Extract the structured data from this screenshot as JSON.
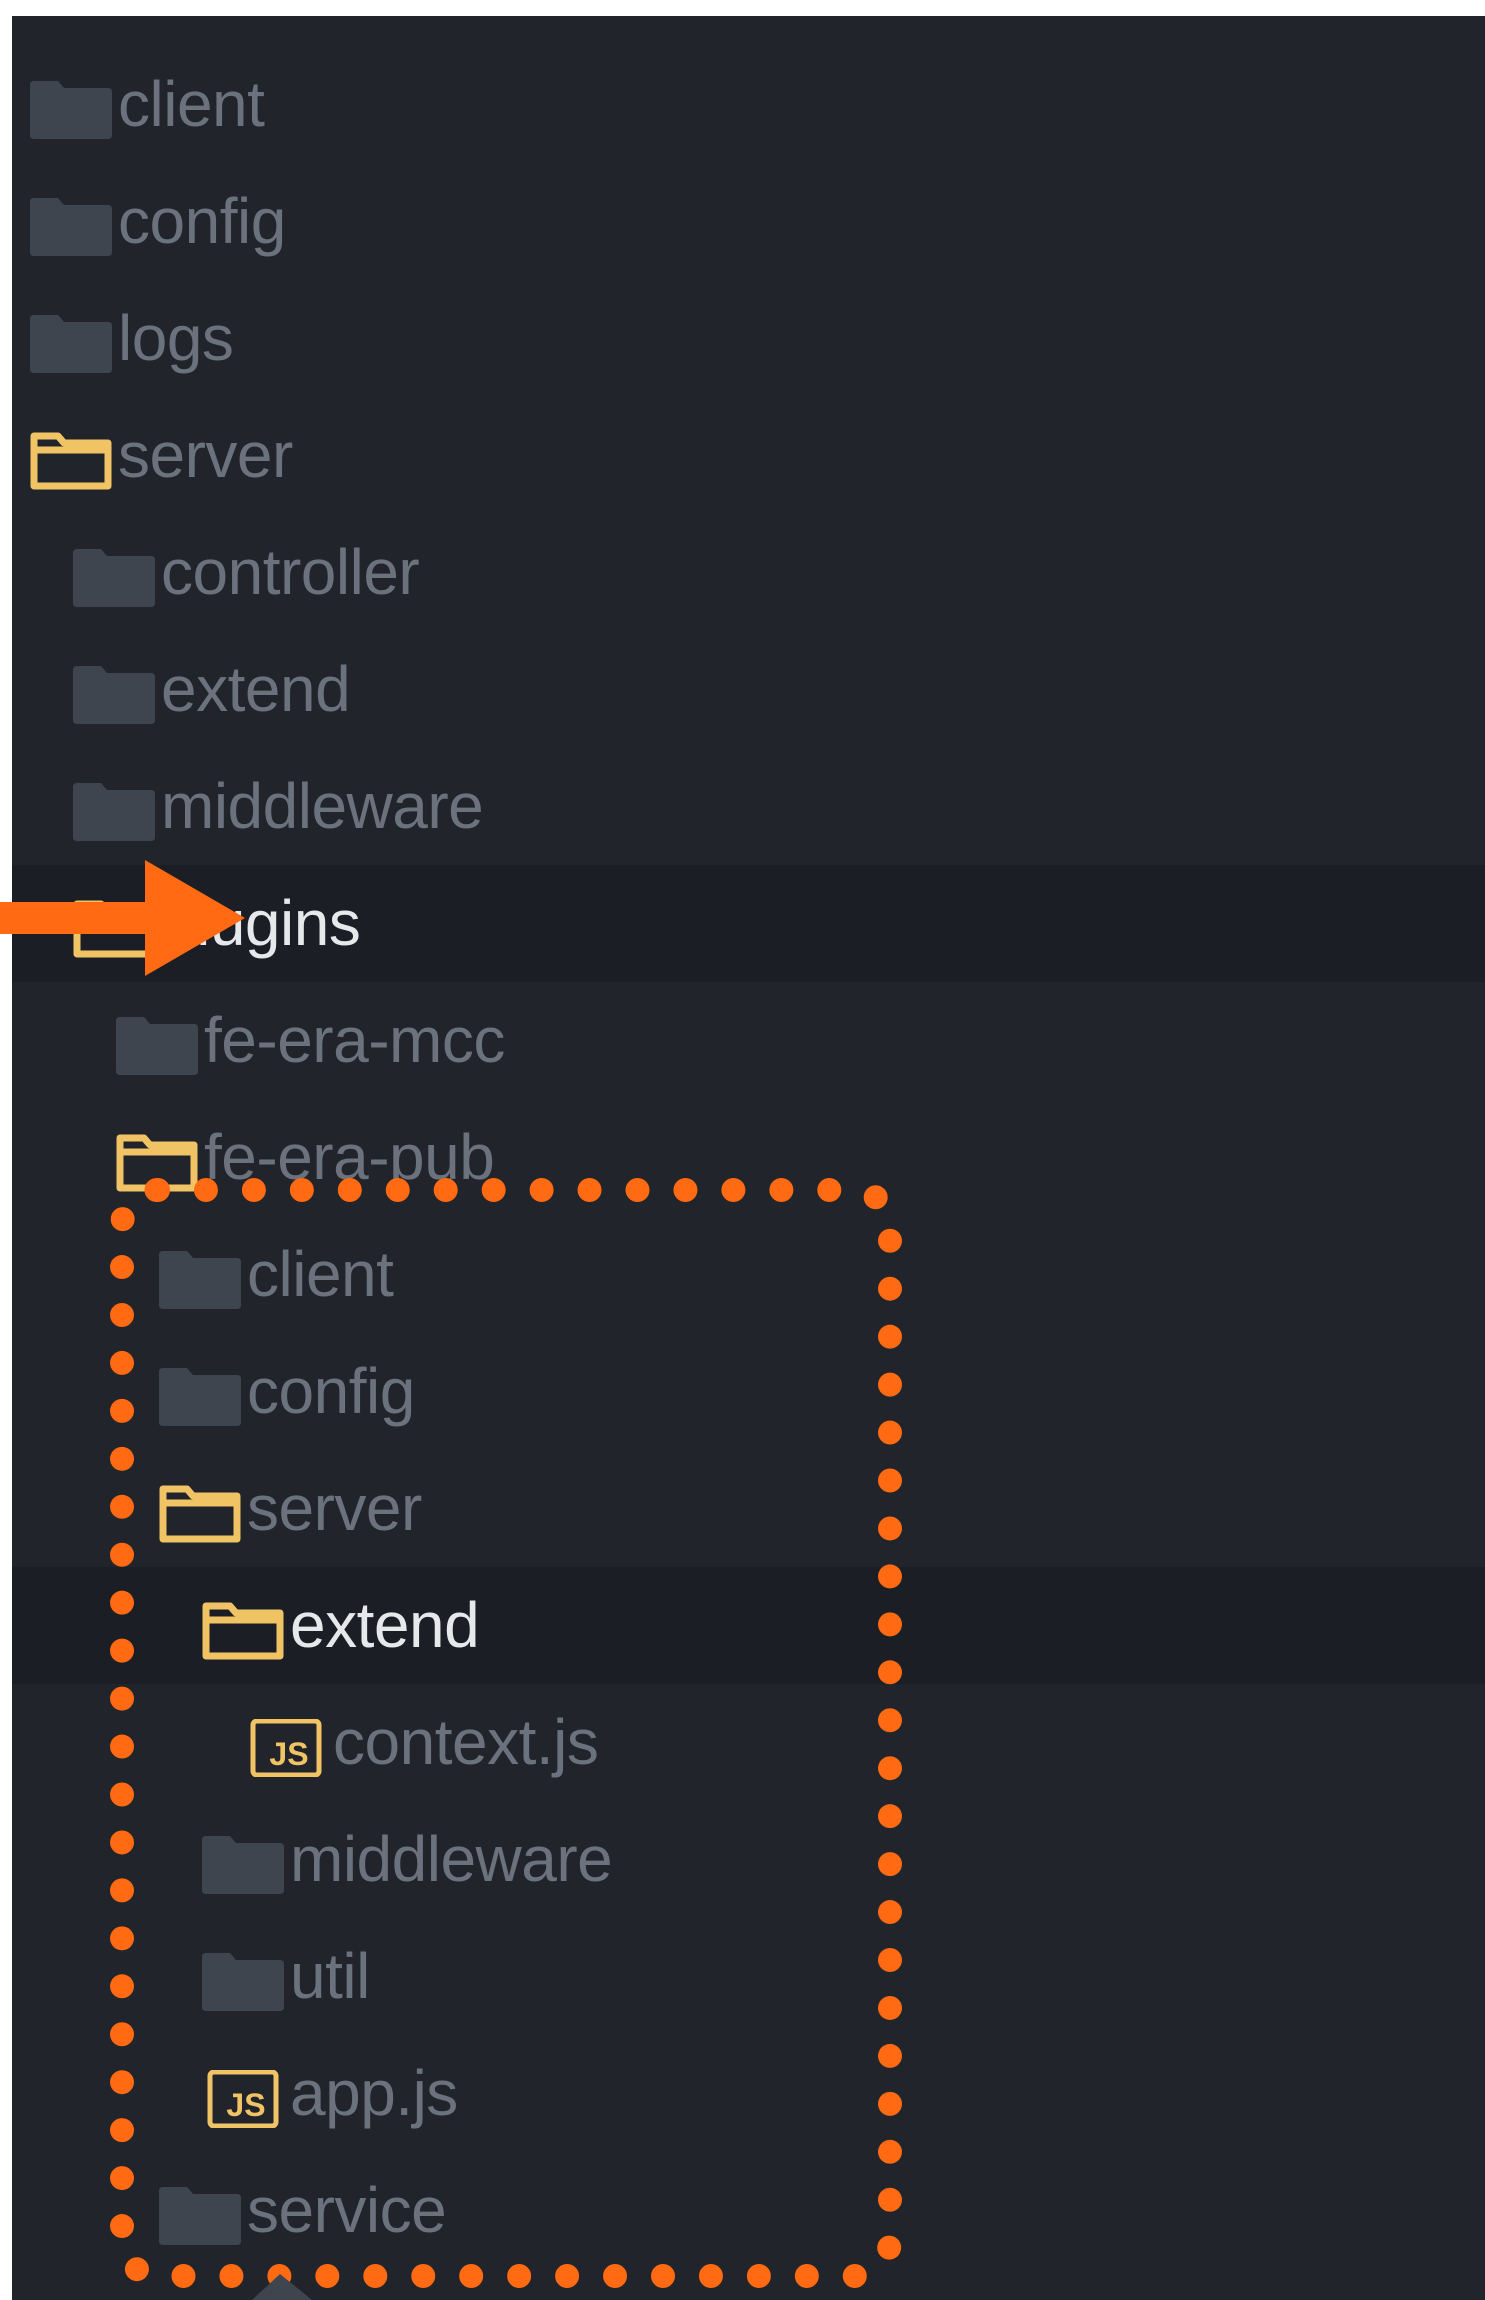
{
  "tree": [
    {
      "label": "client",
      "icon": "folder-closed-icon",
      "level": 0
    },
    {
      "label": "config",
      "icon": "folder-closed-icon",
      "level": 0
    },
    {
      "label": "logs",
      "icon": "folder-closed-icon",
      "level": 0
    },
    {
      "label": "server",
      "icon": "folder-open-icon",
      "level": 0
    },
    {
      "label": "controller",
      "icon": "folder-closed-icon",
      "level": 1
    },
    {
      "label": "extend",
      "icon": "folder-closed-icon",
      "level": 1
    },
    {
      "label": "middleware",
      "icon": "folder-closed-icon",
      "level": 1
    },
    {
      "label": "plugins",
      "icon": "folder-open-icon",
      "level": 1
    },
    {
      "label": "fe-era-mcc",
      "icon": "folder-closed-icon",
      "level": 2
    },
    {
      "label": "fe-era-pub",
      "icon": "folder-open-icon",
      "level": 2
    },
    {
      "label": "client",
      "icon": "folder-closed-icon",
      "level": 3
    },
    {
      "label": "config",
      "icon": "folder-closed-icon",
      "level": 3
    },
    {
      "label": "server",
      "icon": "folder-open-icon",
      "level": 3
    },
    {
      "label": "extend",
      "icon": "folder-open-icon",
      "level": 4
    },
    {
      "label": "context.js",
      "icon": "js-file-icon",
      "level": 5
    },
    {
      "label": "middleware",
      "icon": "folder-closed-icon",
      "level": 4
    },
    {
      "label": "util",
      "icon": "folder-closed-icon",
      "level": 4
    },
    {
      "label": "app.js",
      "icon": "js-file-icon",
      "level": 4
    },
    {
      "label": "service",
      "icon": "folder-closed-icon",
      "level": 3
    }
  ],
  "highlighted_rows": [
    7,
    13
  ],
  "colors": {
    "panel_bg": "#21252b",
    "selected_row_bg": "#1b1f25",
    "folder_closed": "#3f454f",
    "folder_open": "#f0c465",
    "label_dim": "#6b727d",
    "label_bright": "#e6e8eb",
    "annotation": "#ff6a13"
  },
  "annotations": {
    "arrow_target": "plugins",
    "dotted_box_contents": "fe-era-pub children"
  }
}
